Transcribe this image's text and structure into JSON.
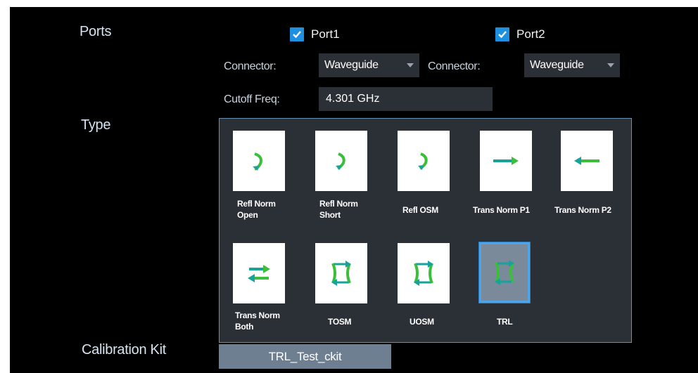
{
  "labels": {
    "ports": "Ports",
    "type": "Type",
    "calibration_kit": "Calibration Kit"
  },
  "ports": [
    {
      "label": "Port1",
      "checked": true,
      "connector_label": "Connector:",
      "connector_value": "Waveguide"
    },
    {
      "label": "Port2",
      "checked": true,
      "connector_label": "Connector:",
      "connector_value": "Waveguide"
    }
  ],
  "cutoff": {
    "label": "Cutoff Freq:",
    "value": "4.301 GHz"
  },
  "types": [
    {
      "label_line1": "Refl Norm",
      "label_line2": "Open",
      "icon": "refl-open-icon"
    },
    {
      "label_line1": "Refl Norm",
      "label_line2": "Short",
      "icon": "refl-short-icon"
    },
    {
      "label_line1": "Refl OSM",
      "label_line2": "",
      "icon": "refl-osm-icon"
    },
    {
      "label_line1": "Trans Norm P1",
      "label_line2": "",
      "icon": "arrow-right-icon"
    },
    {
      "label_line1": "Trans Norm P2",
      "label_line2": "",
      "icon": "arrow-left-icon"
    },
    {
      "label_line1": "Trans Norm",
      "label_line2": "Both",
      "icon": "bidirectional-arrows-icon"
    },
    {
      "label_line1": "TOSM",
      "label_line2": "",
      "icon": "tosm-icon"
    },
    {
      "label_line1": "UOSM",
      "label_line2": "",
      "icon": "uosm-icon"
    },
    {
      "label_line1": "TRL",
      "label_line2": "",
      "icon": "trl-icon",
      "selected": true
    }
  ],
  "calibration_kit_value": "TRL_Test_ckit",
  "colors": {
    "accent": "#1f8fe0",
    "icon_green": "#3bbf3b",
    "icon_teal": "#17a39a",
    "panel": "#2b2f36"
  }
}
